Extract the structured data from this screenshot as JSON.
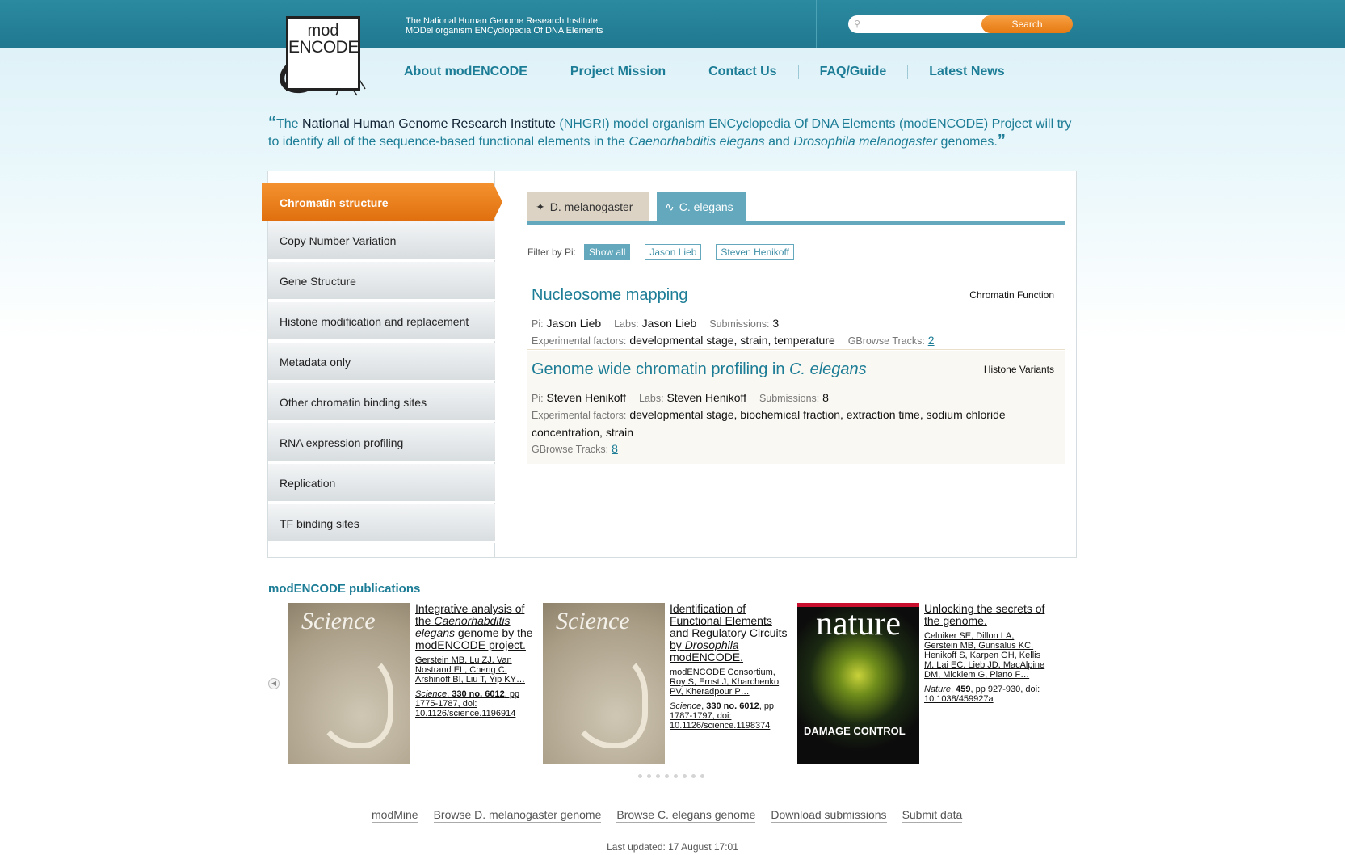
{
  "header": {
    "logo_mod": "mod",
    "logo_encode": "ENCODE",
    "tagline_line1": "The National Human Genome Research Institute",
    "tagline_line2": "MODel organism ENCyclopedia Of DNA Elements",
    "search_placeholder": "",
    "search_button": "Search"
  },
  "nav": [
    "About modENCODE",
    "Project Mission",
    "Contact Us",
    "FAQ/Guide",
    "Latest News"
  ],
  "quote": {
    "part1": "The ",
    "part2": "National Human Genome Research Institute",
    "part3": " (NHGRI) model organism ENCyclopedia Of DNA Elements (modENCODE) Project will try to identify all of the sequence-based functional elements in the ",
    "species1": "Caenorhabditis elegans",
    "part4": " and ",
    "species2": "Drosophila melanogaster",
    "part5": " genomes."
  },
  "sidebar": {
    "active": "Chromatin structure",
    "items": [
      "Copy Number Variation",
      "Gene Structure",
      "Histone modification and replacement",
      "Metadata only",
      "Other chromatin binding sites",
      "RNA expression profiling",
      "Replication",
      "TF binding sites"
    ]
  },
  "tabs": {
    "dmel": "D. melanogaster",
    "cel": "C. elegans"
  },
  "filter": {
    "label": "Filter by Pi:",
    "options": [
      "Show all",
      "Jason Lieb",
      "Steven Henikoff"
    ]
  },
  "labels": {
    "pi": "Pi:",
    "labs": "Labs:",
    "submissions": "Submissions:",
    "factors": "Experimental factors:",
    "tracks": "GBrowse Tracks:"
  },
  "projects": [
    {
      "title": "Nucleosome mapping",
      "category": "Chromatin Function",
      "pi": "Jason Lieb",
      "labs": "Jason Lieb",
      "submissions": "3",
      "factors": "developmental stage, strain, temperature",
      "tracks": "2"
    },
    {
      "title_prefix": "Genome wide chromatin profiling in ",
      "title_species": "C. elegans",
      "category": "Histone Variants",
      "pi": "Steven Henikoff",
      "labs": "Steven Henikoff",
      "submissions": "8",
      "factors": "developmental stage, biochemical fraction, extraction time, sodium chloride concentration, strain",
      "tracks": "8"
    }
  ],
  "publications": {
    "title": "modENCODE publications",
    "items": [
      {
        "cover_masthead": "Science",
        "title_a": "Integrative analysis of the ",
        "title_species": "Caenorhabditis elegans",
        "title_b": " genome by the modENCODE project.",
        "authors": "Gerstein MB, Lu ZJ, Van Nostrand EL, Cheng C, Arshinoff BI, Liu T, Yip KY…",
        "journal": "Science",
        "volume": "330 no. 6012",
        "rest": ", pp 1775-1787, doi: 10.1126/science.1196914"
      },
      {
        "cover_masthead": "Science",
        "title_a": "Identification of Functional Elements and Regulatory Circuits by ",
        "title_species": "Drosophila",
        "title_b": " modENCODE.",
        "authors": "modENCODE Consortium, Roy S, Ernst J, Kharchenko PV, Kheradpour P…",
        "journal": "Science",
        "volume": "330 no. 6012",
        "rest": ", pp 1787-1797, doi: 10.1126/science.1198374"
      },
      {
        "cover_masthead": "nature",
        "cover_headline": "DAMAGE CONTROL",
        "title": "Unlocking the secrets of the genome.",
        "authors": "Celniker SE, Dillon LA, Gerstein MB, Gunsalus KC, Henikoff S, Karpen GH, Kellis M, Lai EC, Lieb JD, MacAlpine DM, Micklem G, Piano F…",
        "journal": "Nature",
        "volume": "459",
        "rest": ", pp 927-930, doi: 10.1038/459927a"
      }
    ]
  },
  "footer": {
    "links": [
      "modMine",
      "Browse D. melanogaster genome",
      "Browse C. elegans genome",
      "Download submissions",
      "Submit data"
    ],
    "updated": "Last updated: 17 August 17:01"
  },
  "colors": {
    "teal": "#1d7d96",
    "orange": "#e67a12",
    "tab_active": "#63a8bd"
  },
  "icons": [
    "search-icon",
    "fly-icon",
    "worm-icon",
    "arrow-left-icon"
  ]
}
